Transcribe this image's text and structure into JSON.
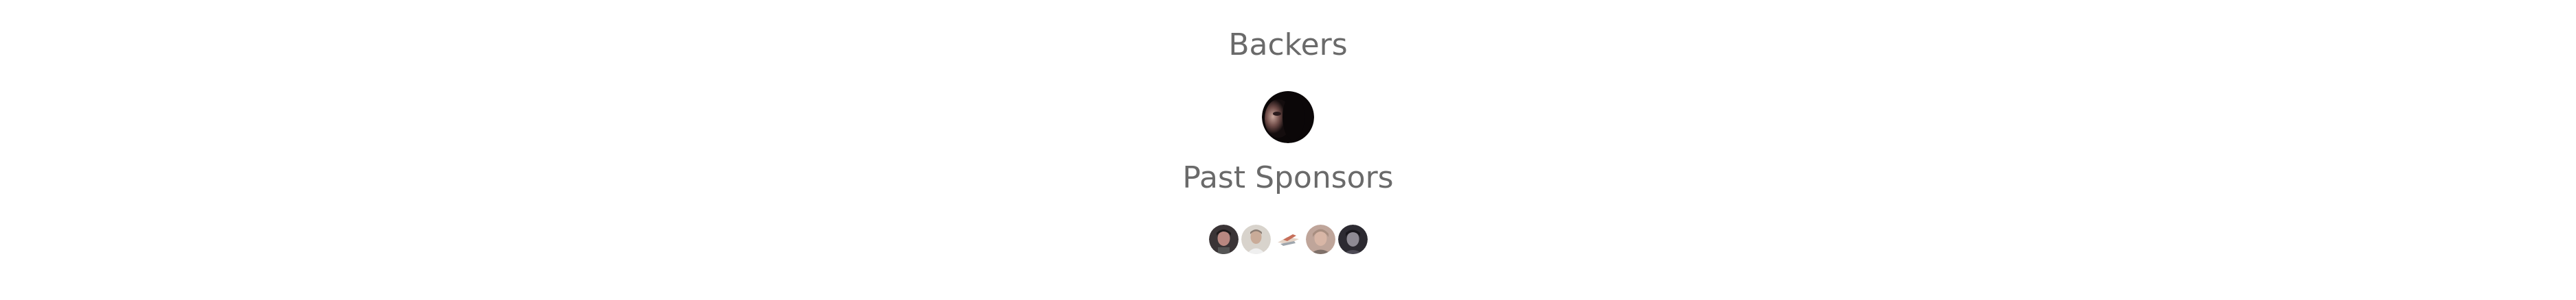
{
  "backers": {
    "title": "Backers",
    "avatars": [
      {
        "icon": "backer-avatar-photo-icon",
        "tone": "dark"
      }
    ]
  },
  "past_sponsors": {
    "title": "Past Sponsors",
    "avatars": [
      {
        "icon": "sponsor-avatar-1-icon",
        "tone": "dark-portrait"
      },
      {
        "icon": "sponsor-avatar-2-icon",
        "tone": "light-portrait"
      },
      {
        "icon": "sponsor-avatar-3-icon",
        "tone": "logo"
      },
      {
        "icon": "sponsor-avatar-4-icon",
        "tone": "light-portrait"
      },
      {
        "icon": "sponsor-avatar-5-icon",
        "tone": "dark-portrait"
      }
    ]
  },
  "colors": {
    "heading": "#6a6a6a",
    "background": "#ffffff"
  }
}
